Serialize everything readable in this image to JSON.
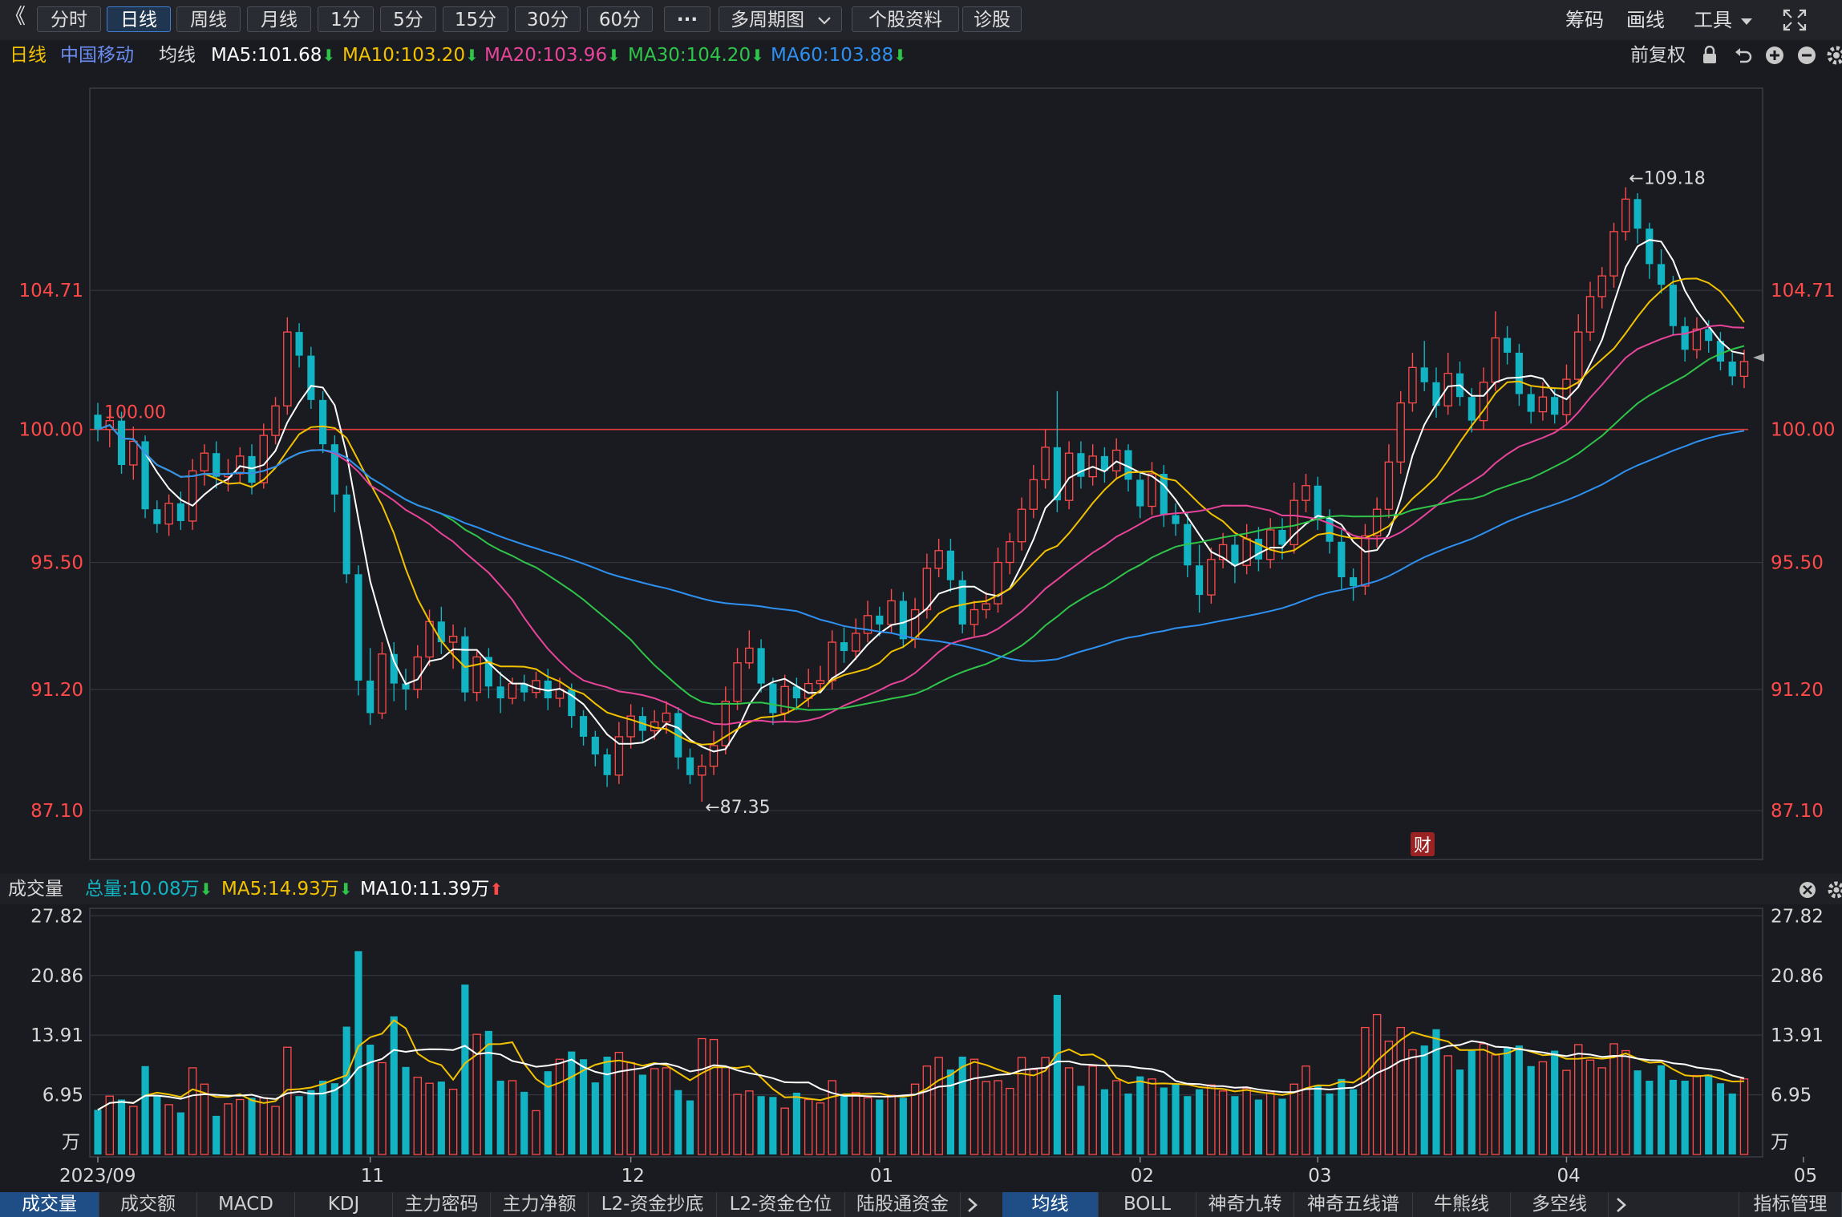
{
  "toolbar": {
    "back_label": "《",
    "periods": [
      "分时",
      "日线",
      "周线",
      "月线",
      "1分",
      "5分",
      "15分",
      "30分",
      "60分"
    ],
    "active_period": "日线",
    "more_label": "···",
    "multi_period_label": "多周期图",
    "company_info_label": "个股资料",
    "diagnose_label": "诊股",
    "right": {
      "chips_label": "筹码",
      "draw_label": "画线",
      "tools_label": "工具"
    }
  },
  "ma_header": {
    "period": "日线",
    "stock_name": "中国移动",
    "ma_type": "均线",
    "ma5": "MA5:101.68",
    "ma10": "MA10:103.20",
    "ma20": "MA20:103.96",
    "ma30": "MA30:104.20",
    "ma60": "MA60:103.88",
    "adjust_label": "前复权"
  },
  "price_chart": {
    "y_ticks": [
      "104.71",
      "100.00",
      "95.50",
      "91.20",
      "87.10"
    ],
    "high_label": "←109.18",
    "low_label": "←87.35",
    "base_label": "100.00",
    "finance_badge": "财"
  },
  "volume_header": {
    "title": "成交量",
    "total": "总量:10.08万",
    "ma5": "MA5:14.93万",
    "ma10": "MA10:11.39万"
  },
  "volume_chart": {
    "y_ticks": [
      "27.82",
      "20.86",
      "13.91",
      "6.95",
      "万"
    ]
  },
  "x_axis": {
    "labels": [
      "2023/09",
      "11",
      "12",
      "01",
      "02",
      "03",
      "04",
      "05"
    ]
  },
  "bottom_tabs_left": [
    "成交量",
    "成交额",
    "MACD",
    "KDJ",
    "主力密码",
    "主力净额",
    "L2-资金抄底",
    "L2-资金仓位",
    "陆股通资金"
  ],
  "bottom_tabs_right": [
    "均线",
    "BOLL",
    "神奇九转",
    "神奇五线谱",
    "牛熊线",
    "多空线"
  ],
  "indicator_manage_label": "指标管理",
  "colors": {
    "up": "#ff4a4a",
    "down": "#12b4c3",
    "ma5": "#ffffff",
    "ma10": "#f2c200",
    "ma20": "#e8449a",
    "ma30": "#2fc44a",
    "ma60": "#2e90f0",
    "baseline": "#e03c3c"
  },
  "chart_data": {
    "type": "candlestick",
    "price_axis": {
      "ylim": [
        85.5,
        111.5
      ],
      "ticks": [
        104.71,
        100.0,
        95.5,
        91.2,
        87.1
      ]
    },
    "volume_axis": {
      "ylim": [
        0,
        28.5
      ],
      "ticks": [
        27.82,
        20.86,
        13.91,
        6.95
      ],
      "unit": "万"
    },
    "months": [
      {
        "label": "2023/09",
        "index": 0
      },
      {
        "label": "11",
        "index": 23
      },
      {
        "label": "12",
        "index": 45
      },
      {
        "label": "01",
        "index": 66
      },
      {
        "label": "02",
        "index": 88
      },
      {
        "label": "03",
        "index": 103
      },
      {
        "label": "04",
        "index": 124
      },
      {
        "label": "05",
        "index": 144
      }
    ],
    "candles": [
      [
        100.5,
        100.0,
        100.9,
        99.6,
        5.2
      ],
      [
        100.0,
        100.3,
        100.7,
        99.4,
        6.8
      ],
      [
        100.3,
        98.8,
        100.6,
        98.5,
        6.4
      ],
      [
        98.8,
        99.6,
        100.1,
        98.3,
        5.6
      ],
      [
        99.6,
        97.3,
        99.8,
        97.0,
        10.3
      ],
      [
        97.3,
        96.8,
        97.6,
        96.5,
        6.9
      ],
      [
        96.8,
        97.5,
        97.8,
        96.4,
        5.8
      ],
      [
        97.5,
        96.9,
        97.9,
        96.6,
        4.9
      ],
      [
        96.9,
        98.6,
        99.0,
        96.6,
        10.1
      ],
      [
        98.6,
        99.2,
        99.5,
        98.1,
        8.2
      ],
      [
        99.2,
        98.4,
        99.6,
        98.0,
        4.5
      ],
      [
        98.4,
        98.5,
        99.0,
        97.9,
        5.9
      ],
      [
        98.5,
        99.1,
        99.4,
        98.2,
        6.4
      ],
      [
        99.1,
        98.2,
        99.5,
        97.8,
        6.6
      ],
      [
        98.2,
        99.8,
        100.2,
        98.0,
        6.6
      ],
      [
        99.8,
        100.8,
        101.1,
        99.5,
        5.6
      ],
      [
        100.8,
        103.3,
        103.8,
        100.5,
        12.5
      ],
      [
        103.3,
        102.5,
        103.6,
        102.1,
        6.8
      ],
      [
        102.5,
        101.0,
        102.8,
        100.7,
        7.5
      ],
      [
        101.0,
        99.5,
        101.3,
        99.2,
        8.6
      ],
      [
        99.5,
        97.8,
        99.8,
        97.2,
        8.3
      ],
      [
        97.8,
        95.1,
        98.1,
        94.8,
        14.9
      ],
      [
        95.1,
        91.5,
        95.4,
        91.0,
        23.7
      ],
      [
        91.5,
        90.4,
        92.6,
        90.0,
        12.8
      ],
      [
        90.4,
        92.4,
        92.8,
        90.2,
        10.7
      ],
      [
        92.4,
        91.4,
        92.8,
        90.8,
        16.1
      ],
      [
        91.4,
        91.2,
        91.9,
        90.5,
        10.2
      ],
      [
        91.2,
        92.3,
        92.7,
        90.9,
        9.0
      ],
      [
        92.3,
        93.5,
        93.9,
        92.0,
        8.3
      ],
      [
        93.5,
        92.8,
        94.0,
        92.4,
        8.5
      ],
      [
        92.8,
        93.0,
        93.4,
        91.9,
        7.6
      ],
      [
        93.0,
        91.1,
        93.3,
        90.8,
        19.8
      ],
      [
        91.1,
        92.3,
        92.5,
        90.8,
        14.0
      ],
      [
        92.3,
        91.3,
        92.6,
        90.9,
        14.4
      ],
      [
        91.3,
        90.9,
        91.8,
        90.4,
        8.6
      ],
      [
        90.9,
        91.4,
        91.6,
        90.7,
        8.6
      ],
      [
        91.4,
        91.1,
        91.7,
        90.8,
        7.3
      ],
      [
        91.1,
        91.5,
        91.8,
        90.9,
        5.1
      ],
      [
        91.5,
        90.9,
        91.9,
        90.5,
        9.7
      ],
      [
        90.9,
        91.2,
        91.6,
        90.6,
        11.1
      ],
      [
        91.2,
        90.3,
        91.4,
        89.9,
        12.0
      ],
      [
        90.3,
        89.6,
        90.5,
        89.3,
        11.1
      ],
      [
        89.6,
        89.0,
        89.8,
        88.6,
        8.4
      ],
      [
        89.0,
        88.3,
        89.2,
        87.9,
        11.4
      ],
      [
        88.3,
        89.6,
        90.1,
        88.0,
        11.9
      ],
      [
        89.6,
        90.3,
        90.7,
        89.2,
        10.7
      ],
      [
        90.3,
        89.8,
        90.6,
        89.4,
        9.3
      ],
      [
        89.8,
        90.1,
        90.5,
        89.5,
        10.0
      ],
      [
        90.1,
        90.4,
        90.8,
        89.7,
        10.1
      ],
      [
        90.4,
        88.9,
        90.6,
        88.5,
        7.5
      ],
      [
        88.9,
        88.3,
        89.2,
        88.0,
        6.3
      ],
      [
        88.3,
        88.6,
        89.0,
        87.4,
        13.5
      ],
      [
        88.6,
        89.3,
        89.8,
        88.3,
        13.4
      ],
      [
        89.3,
        90.8,
        91.3,
        89.0,
        10.2
      ],
      [
        90.8,
        92.1,
        92.6,
        90.5,
        7.0
      ],
      [
        92.1,
        92.6,
        93.2,
        91.9,
        7.4
      ],
      [
        92.6,
        91.4,
        92.9,
        91.1,
        6.8
      ],
      [
        91.4,
        90.4,
        91.6,
        90.0,
        6.7
      ],
      [
        90.4,
        91.3,
        91.7,
        90.1,
        5.4
      ],
      [
        91.3,
        90.9,
        91.6,
        90.5,
        7.2
      ],
      [
        90.9,
        91.4,
        91.9,
        90.6,
        6.4
      ],
      [
        91.4,
        91.5,
        92.0,
        91.1,
        6.0
      ],
      [
        91.5,
        92.8,
        93.2,
        91.2,
        8.6
      ],
      [
        92.8,
        92.5,
        93.3,
        92.1,
        6.9
      ],
      [
        92.5,
        93.1,
        93.6,
        92.2,
        7.2
      ],
      [
        93.1,
        93.7,
        94.2,
        92.8,
        6.6
      ],
      [
        93.7,
        93.4,
        94.0,
        93.0,
        6.4
      ],
      [
        93.4,
        94.2,
        94.6,
        93.1,
        6.9
      ],
      [
        94.2,
        92.9,
        94.5,
        92.6,
        6.6
      ],
      [
        92.9,
        93.9,
        94.3,
        92.6,
        8.2
      ],
      [
        93.9,
        95.3,
        95.8,
        93.6,
        10.3
      ],
      [
        95.3,
        95.9,
        96.3,
        95.0,
        11.3
      ],
      [
        95.9,
        94.9,
        96.3,
        94.5,
        9.9
      ],
      [
        94.9,
        93.4,
        95.2,
        93.1,
        11.4
      ],
      [
        93.4,
        93.9,
        94.2,
        93.0,
        11.1
      ],
      [
        93.9,
        94.1,
        94.5,
        93.6,
        8.5
      ],
      [
        94.1,
        95.5,
        96.0,
        93.8,
        8.6
      ],
      [
        95.5,
        96.2,
        96.5,
        95.1,
        7.7
      ],
      [
        96.2,
        97.3,
        97.7,
        95.9,
        11.3
      ],
      [
        97.3,
        98.3,
        98.8,
        97.0,
        9.9
      ],
      [
        98.3,
        99.4,
        100.0,
        98.0,
        11.3
      ],
      [
        99.4,
        97.6,
        101.3,
        97.2,
        18.6
      ],
      [
        97.6,
        99.2,
        99.6,
        97.3,
        10.1
      ],
      [
        99.2,
        98.4,
        99.6,
        98.0,
        8.0
      ],
      [
        98.4,
        99.1,
        99.5,
        98.1,
        10.3
      ],
      [
        99.1,
        98.6,
        99.4,
        98.2,
        7.6
      ],
      [
        98.6,
        99.3,
        99.7,
        98.3,
        8.6
      ],
      [
        99.3,
        98.3,
        99.5,
        97.9,
        7.1
      ],
      [
        98.3,
        97.4,
        98.6,
        97.0,
        9.1
      ],
      [
        97.4,
        98.5,
        98.9,
        97.1,
        8.8
      ],
      [
        98.5,
        97.1,
        98.8,
        96.7,
        7.8
      ],
      [
        97.1,
        96.8,
        97.5,
        96.4,
        8.3
      ],
      [
        96.8,
        95.4,
        97.2,
        95.0,
        6.8
      ],
      [
        95.4,
        94.4,
        96.1,
        93.8,
        7.6
      ],
      [
        94.4,
        95.6,
        96.0,
        94.1,
        8.1
      ],
      [
        95.6,
        96.1,
        96.5,
        95.3,
        7.4
      ],
      [
        96.1,
        95.4,
        96.4,
        94.8,
        6.8
      ],
      [
        95.4,
        96.3,
        96.8,
        95.1,
        7.7
      ],
      [
        96.3,
        95.6,
        96.7,
        95.2,
        6.4
      ],
      [
        95.6,
        96.6,
        97.0,
        95.3,
        7.2
      ],
      [
        96.6,
        96.1,
        97.0,
        95.6,
        6.5
      ],
      [
        96.1,
        97.6,
        98.2,
        95.8,
        8.2
      ],
      [
        97.6,
        98.1,
        98.5,
        97.2,
        10.3
      ],
      [
        98.1,
        97.0,
        98.4,
        96.6,
        8.1
      ],
      [
        97.0,
        96.2,
        97.3,
        95.8,
        7.1
      ],
      [
        96.2,
        95.0,
        96.6,
        94.6,
        8.8
      ],
      [
        95.0,
        94.7,
        95.3,
        94.2,
        7.6
      ],
      [
        94.7,
        96.4,
        96.8,
        94.4,
        14.8
      ],
      [
        96.4,
        97.3,
        97.7,
        96.0,
        16.3
      ],
      [
        97.3,
        98.9,
        99.5,
        97.0,
        13.2
      ],
      [
        98.9,
        100.9,
        101.3,
        98.5,
        14.8
      ],
      [
        100.9,
        102.1,
        102.6,
        100.6,
        12.2
      ],
      [
        102.1,
        101.6,
        103.0,
        101.3,
        12.7
      ],
      [
        101.6,
        100.8,
        102.1,
        100.4,
        14.6
      ],
      [
        100.8,
        101.9,
        102.6,
        100.5,
        11.5
      ],
      [
        101.9,
        101.1,
        102.3,
        100.8,
        9.9
      ],
      [
        101.1,
        100.3,
        101.4,
        99.9,
        12.2
      ],
      [
        100.3,
        101.6,
        102.1,
        100.0,
        12.9
      ],
      [
        101.6,
        103.1,
        104.0,
        101.3,
        11.6
      ],
      [
        103.1,
        102.6,
        103.5,
        102.2,
        12.4
      ],
      [
        102.6,
        101.2,
        102.9,
        100.8,
        12.7
      ],
      [
        101.2,
        100.6,
        101.5,
        100.2,
        10.3
      ],
      [
        100.6,
        101.1,
        101.6,
        100.3,
        10.8
      ],
      [
        101.1,
        100.5,
        101.4,
        100.2,
        12.1
      ],
      [
        100.5,
        101.7,
        102.2,
        100.2,
        9.8
      ],
      [
        101.7,
        103.3,
        103.9,
        101.4,
        12.8
      ],
      [
        103.3,
        104.5,
        105.0,
        103.0,
        11.0
      ],
      [
        104.5,
        105.2,
        105.5,
        104.1,
        10.1
      ],
      [
        105.2,
        106.7,
        107.0,
        104.8,
        12.9
      ],
      [
        106.7,
        107.8,
        108.2,
        106.4,
        12.1
      ],
      [
        107.8,
        106.8,
        108.0,
        106.3,
        9.8
      ],
      [
        106.8,
        105.6,
        107.0,
        105.1,
        8.6
      ],
      [
        105.6,
        104.9,
        106.1,
        104.6,
        10.4
      ],
      [
        104.9,
        103.5,
        105.2,
        103.2,
        8.7
      ],
      [
        103.5,
        102.7,
        103.8,
        102.3,
        8.6
      ],
      [
        102.7,
        103.4,
        103.8,
        102.4,
        9.2
      ],
      [
        103.4,
        103.0,
        103.7,
        102.6,
        9.3
      ],
      [
        103.0,
        102.3,
        103.3,
        102.0,
        8.3
      ],
      [
        102.3,
        101.8,
        102.6,
        101.5,
        7.1
      ],
      [
        101.8,
        102.3,
        102.7,
        101.4,
        8.8
      ]
    ],
    "ma_series": [
      {
        "name": "MA5",
        "color": "#ffffff"
      },
      {
        "name": "MA10",
        "color": "#f2c200"
      },
      {
        "name": "MA20",
        "color": "#e8449a"
      },
      {
        "name": "MA30",
        "color": "#2fc44a"
      },
      {
        "name": "MA60",
        "color": "#2e90f0"
      }
    ],
    "reference_line": 100.0,
    "annotations": [
      {
        "text": "←109.18",
        "value": 109.18
      },
      {
        "text": "←87.35",
        "value": 87.35
      }
    ]
  }
}
